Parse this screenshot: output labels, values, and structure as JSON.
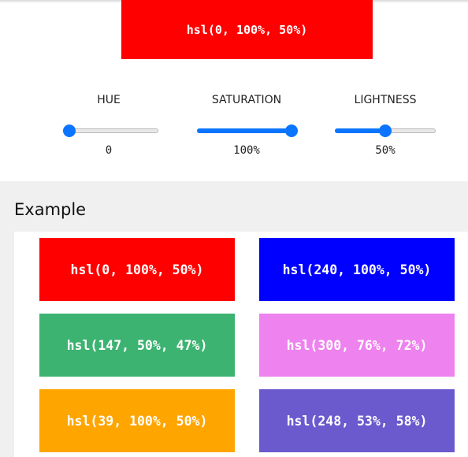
{
  "preview": {
    "text": "hsl(0, 100%, 50%)",
    "color": "#ff0000"
  },
  "controls": {
    "hue": {
      "label": "HUE",
      "value": "0",
      "fraction": 0.0
    },
    "saturation": {
      "label": "SATURATION",
      "value": "100%",
      "fraction": 1.0
    },
    "lightness": {
      "label": "LIGHTNESS",
      "value": "50%",
      "fraction": 0.5
    },
    "accent_color": "#0b75ff"
  },
  "example": {
    "title": "Example",
    "swatches": [
      {
        "text": "hsl(0, 100%, 50%)",
        "color": "#ff0000"
      },
      {
        "text": "hsl(240, 100%, 50%)",
        "color": "#0000ff"
      },
      {
        "text": "hsl(147, 50%, 47%)",
        "color": "#3cb371"
      },
      {
        "text": "hsl(300, 76%, 72%)",
        "color": "#ee82ee"
      },
      {
        "text": "hsl(39, 100%, 50%)",
        "color": "#ffa500"
      },
      {
        "text": "hsl(248, 53%, 58%)",
        "color": "#6a5acd"
      }
    ]
  }
}
